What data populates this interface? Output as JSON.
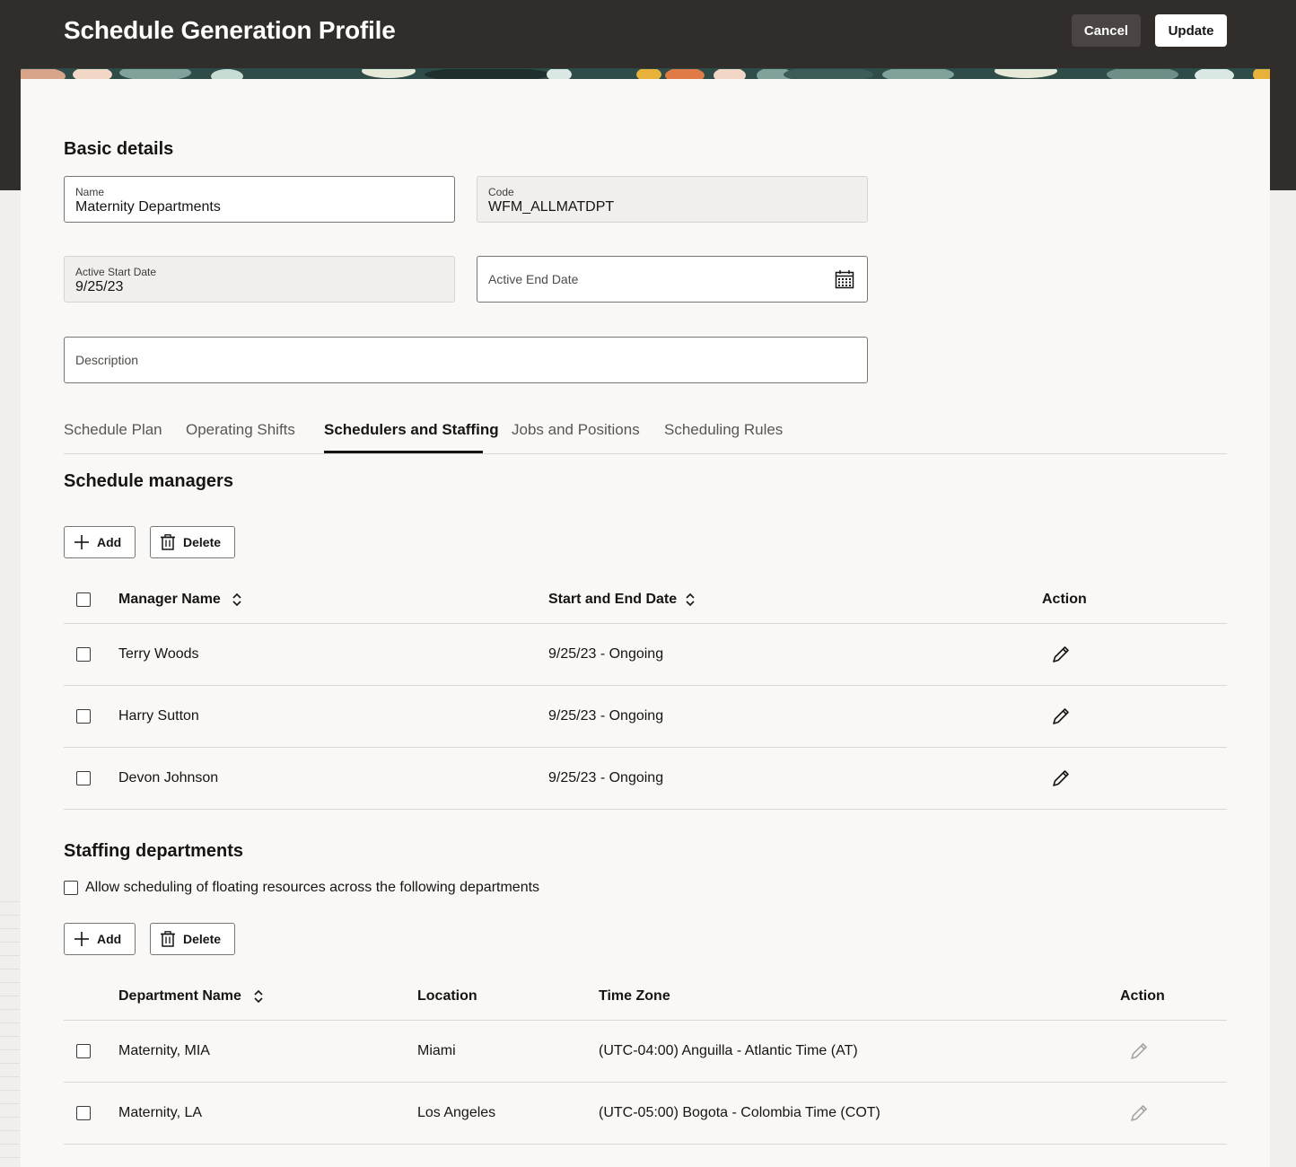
{
  "header": {
    "title": "Schedule Generation Profile",
    "cancel_label": "Cancel",
    "update_label": "Update"
  },
  "basic_details": {
    "section_title": "Basic details",
    "name": {
      "label": "Name",
      "value": "Maternity Departments"
    },
    "code": {
      "label": "Code",
      "value": "WFM_ALLMATDPT"
    },
    "active_start_date": {
      "label": "Active Start Date",
      "value": "9/25/23"
    },
    "active_end_date": {
      "placeholder": "Active End Date"
    },
    "description": {
      "placeholder": "Description"
    }
  },
  "tabs": [
    {
      "label": "Schedule Plan"
    },
    {
      "label": "Operating Shifts"
    },
    {
      "label": "Schedulers and Staffing"
    },
    {
      "label": "Jobs and Positions"
    },
    {
      "label": "Scheduling Rules"
    }
  ],
  "active_tab": "Schedulers and Staffing",
  "schedule_managers": {
    "section_title": "Schedule managers",
    "add_label": "Add",
    "delete_label": "Delete",
    "columns": {
      "name": "Manager Name",
      "dates": "Start and End Date",
      "action": "Action"
    },
    "rows": [
      {
        "name": "Terry Woods",
        "dates": "9/25/23 - Ongoing"
      },
      {
        "name": "Harry Sutton",
        "dates": "9/25/23 - Ongoing"
      },
      {
        "name": "Devon Johnson",
        "dates": "9/25/23 - Ongoing"
      }
    ]
  },
  "staffing_departments": {
    "section_title": "Staffing departments",
    "allow_floating_label": "Allow scheduling of floating resources across the following departments",
    "add_label": "Add",
    "delete_label": "Delete",
    "columns": {
      "department": "Department Name",
      "location": "Location",
      "timezone": "Time Zone",
      "action": "Action"
    },
    "rows": [
      {
        "department": "Maternity, MIA",
        "location": "Miami",
        "timezone": "(UTC-04:00) Anguilla - Atlantic Time (AT)"
      },
      {
        "department": "Maternity, LA",
        "location": "Los Angeles",
        "timezone": "(UTC-05:00) Bogota - Colombia Time (COT)"
      }
    ]
  },
  "colors": {
    "header_bg": "#312d2a",
    "card_bg": "#f9f8f6",
    "page_bg": "#f1efed",
    "text": "#161513",
    "active_tab_underline": "#161513"
  }
}
